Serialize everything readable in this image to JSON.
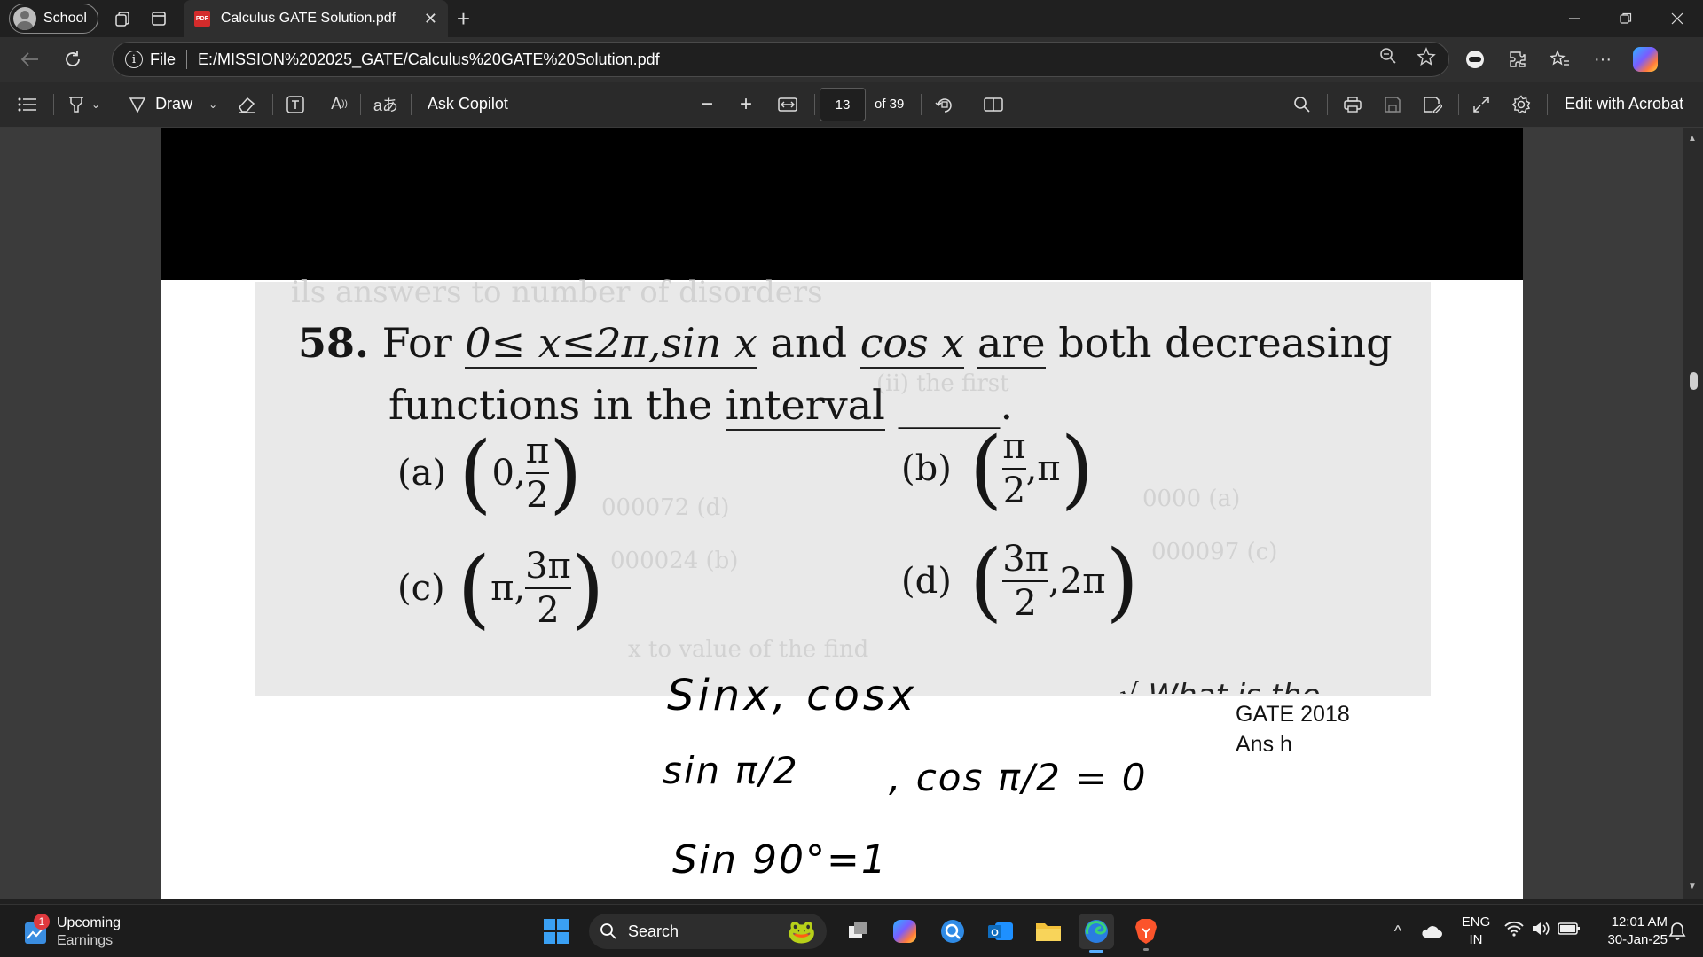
{
  "titlebar": {
    "profile_label": "School",
    "tab_title": "Calculus GATE Solution.pdf",
    "tab_icon_text": "PDF",
    "close_symbol": "✕",
    "new_tab_symbol": "+"
  },
  "navbar": {
    "file_label": "File",
    "url": "E:/MISSION%202025_GATE/Calculus%20GATE%20Solution.pdf"
  },
  "pdf_toolbar": {
    "draw_label": "Draw",
    "ask_copilot_label": "Ask Copilot",
    "minus": "−",
    "plus": "+",
    "current_page": "13",
    "total_pages": "of 39",
    "edit_label": "Edit with Acrobat",
    "font_label": "A",
    "translate_label": "aあ"
  },
  "question": {
    "number": "58.",
    "line1_a": "For",
    "line1_b": "0≤ x≤2π,",
    "line1_c": "sin x",
    "line1_d": "and",
    "line1_e": "cos x",
    "line1_f": "are",
    "line1_g": "both",
    "line1_h": "decreasing",
    "line2_a": "functions in the",
    "line2_b": "interval",
    "line2_c": "_____.",
    "options": [
      {
        "label": "(a)",
        "prefix": "0,",
        "num": "π",
        "den": "2",
        "suffix": ""
      },
      {
        "label": "(b)",
        "prefix": "",
        "num": "π",
        "den": "2",
        "suffix": ",π"
      },
      {
        "label": "(c)",
        "prefix": "π,",
        "num": "3π",
        "den": "2",
        "suffix": ""
      },
      {
        "label": "(d)",
        "prefix": "",
        "num": "3π",
        "den": "2",
        "suffix": ",2π"
      }
    ]
  },
  "handwriting": {
    "line1": "Sinx, cosx",
    "line2a": "sin π/2",
    "line2b": ", cos π/2 = 0",
    "line3": "Sin 90°=1",
    "cutoff": "√ What is the"
  },
  "note": {
    "line1": "GATE 2018",
    "line2": "Ans h"
  },
  "taskbar": {
    "badge_count": "1",
    "widget_title": "Upcoming",
    "widget_sub": "Earnings",
    "search_label": "Search",
    "lang_top": "ENG",
    "lang_bottom": "IN",
    "time": "12:01 AM",
    "date": "30-Jan-25"
  },
  "colors": {
    "edge_blue": "#2a7de1",
    "brave_orange": "#fb542b",
    "folder_yellow": "#f3c13a",
    "outlook_blue": "#0f6cbd",
    "windows_blue": "#3aa0f3"
  }
}
